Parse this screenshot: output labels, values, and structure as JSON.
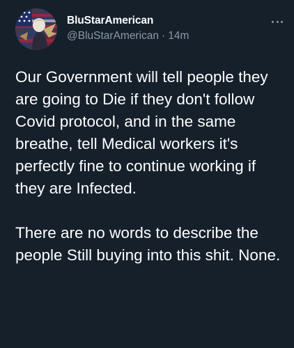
{
  "tweet": {
    "display_name": "BluStarAmerican",
    "handle": "@BluStarAmerican",
    "separator": "·",
    "timestamp": "14m",
    "more_icon": "more-horizontal-icon",
    "paragraphs": [
      "Our Government will tell people they are going to Die if they don't follow Covid protocol, and in the same breathe, tell Medical workers it's perfectly fine to continue working if they are Infected.",
      "There are no words to describe the people Still buying into this shit. None."
    ]
  },
  "colors": {
    "background": "#15202b",
    "text": "#ffffff",
    "secondary_text": "#8899a6"
  }
}
